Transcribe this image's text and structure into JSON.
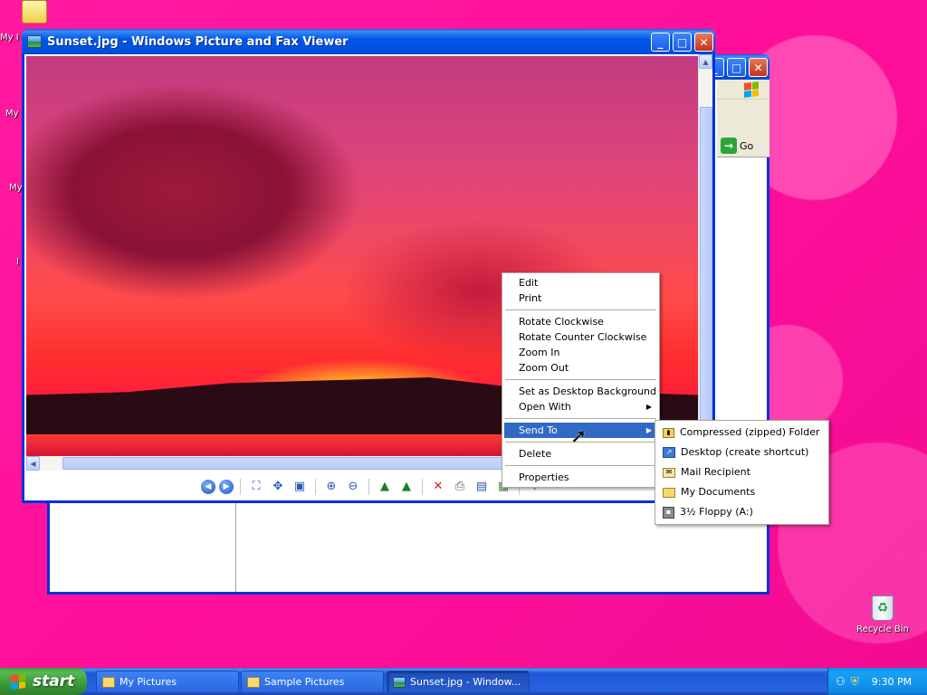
{
  "desktop": {
    "icons": [
      {
        "label": "My I"
      },
      {
        "label": "My"
      },
      {
        "label": "My"
      },
      {
        "label": "I"
      },
      {
        "label": "Recycle Bin"
      }
    ]
  },
  "explorer": {
    "go_label": "Go"
  },
  "viewer": {
    "title": "Sunset.jpg - Windows Picture and Fax Viewer",
    "toolbar": [
      {
        "icon": "previous-image-icon"
      },
      {
        "icon": "next-image-icon"
      },
      {
        "icon": "best-fit-icon"
      },
      {
        "icon": "actual-size-icon"
      },
      {
        "icon": "slideshow-icon"
      },
      {
        "icon": "zoom-in-icon"
      },
      {
        "icon": "zoom-out-icon"
      },
      {
        "icon": "rotate-clockwise-icon"
      },
      {
        "icon": "rotate-counterclockwise-icon"
      },
      {
        "icon": "delete-icon"
      },
      {
        "icon": "print-icon"
      },
      {
        "icon": "save-icon"
      },
      {
        "icon": "edit-icon"
      },
      {
        "icon": "help-icon"
      }
    ]
  },
  "context_menu": {
    "items": [
      {
        "label": "Edit"
      },
      {
        "label": "Print"
      },
      {
        "label": "Rotate Clockwise"
      },
      {
        "label": "Rotate Counter Clockwise"
      },
      {
        "label": "Zoom In"
      },
      {
        "label": "Zoom Out"
      },
      {
        "label": "Set as Desktop Background"
      },
      {
        "label": "Open With"
      },
      {
        "label": "Send To"
      },
      {
        "label": "Delete"
      },
      {
        "label": "Properties"
      }
    ],
    "highlighted": "Send To"
  },
  "send_to_menu": {
    "items": [
      {
        "label": "Compressed (zipped) Folder",
        "icon": "zip-folder-icon"
      },
      {
        "label": "Desktop (create shortcut)",
        "icon": "desktop-icon"
      },
      {
        "label": "Mail Recipient",
        "icon": "mail-icon"
      },
      {
        "label": "My Documents",
        "icon": "folder-icon"
      },
      {
        "label": "3½ Floppy (A:)",
        "icon": "floppy-icon"
      }
    ]
  },
  "taskbar": {
    "start_label": "start",
    "tasks": [
      {
        "label": "My Pictures"
      },
      {
        "label": "Sample Pictures"
      },
      {
        "label": "Sunset.jpg - Window..."
      }
    ],
    "clock": "9:30 PM"
  },
  "colors": {
    "desktop": "#ff1493",
    "title_blue": "#0058e6",
    "menu_highlight": "#316ac5",
    "start_green": "#3a9b35"
  }
}
